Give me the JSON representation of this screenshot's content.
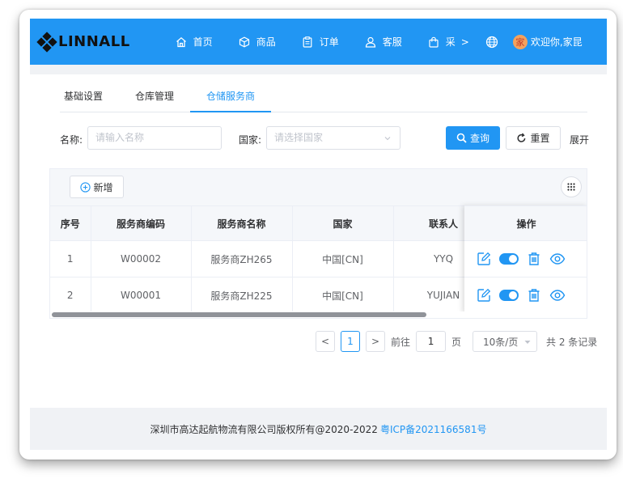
{
  "brand": {
    "logo_text": "LINNALL"
  },
  "nav": {
    "items": [
      {
        "label": "首页",
        "icon": "home-icon"
      },
      {
        "label": "商品",
        "icon": "box-icon"
      },
      {
        "label": "订单",
        "icon": "clipboard-icon"
      },
      {
        "label": "客服",
        "icon": "user-icon"
      },
      {
        "label": "采",
        "icon": "bag-icon"
      }
    ],
    "more": ">",
    "greeting": "欢迎你,家昆",
    "avatar_char": "家"
  },
  "tabs": [
    {
      "label": "基础设置"
    },
    {
      "label": "仓库管理"
    },
    {
      "label": "仓储服务商",
      "active": true
    }
  ],
  "filters": {
    "name_label": "名称:",
    "name_placeholder": "请输入名称",
    "country_label": "国家:",
    "country_placeholder": "请选择国家",
    "query_label": "查询",
    "reset_label": "重置",
    "expand_label": "展开"
  },
  "table": {
    "add_label": "新增",
    "columns": [
      "序号",
      "服务商编码",
      "服务商名称",
      "国家",
      "联系人",
      "操作"
    ],
    "rows": [
      {
        "index": "1",
        "code": "W00002",
        "name": "服务商ZH265",
        "country": "中国[CN]",
        "contact": "YYQ",
        "enabled": true
      },
      {
        "index": "2",
        "code": "W00001",
        "name": "服务商ZH225",
        "country": "中国[CN]",
        "contact": "YUJIAN",
        "enabled": true
      }
    ]
  },
  "pagination": {
    "prev": "<",
    "current_page": "1",
    "next": ">",
    "goto_label": "前往",
    "goto_value": "1",
    "page_unit": "页",
    "page_size": "10条/页",
    "total_text": "共 2 条记录"
  },
  "footer": {
    "copyright": "深圳市高达起航物流有限公司版权所有@2020-2022",
    "icp": "粤ICP备2021166581号"
  },
  "colors": {
    "primary": "#2196f3",
    "header_bg": "#2196f3"
  }
}
